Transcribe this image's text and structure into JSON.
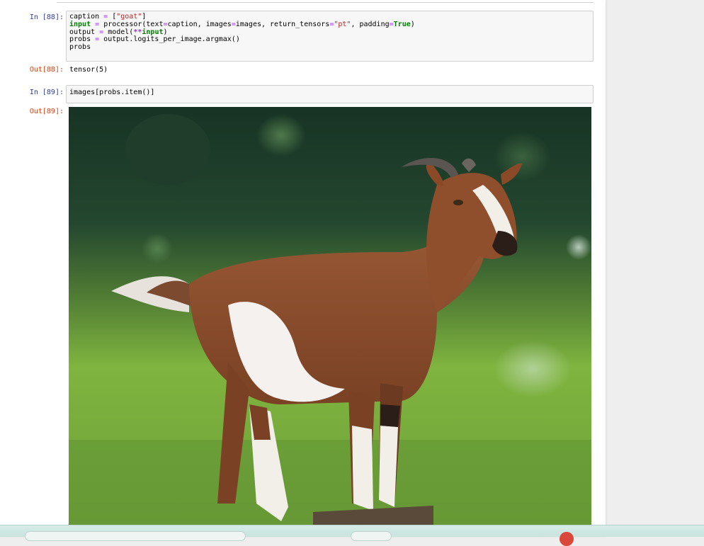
{
  "cells": [
    {
      "in_prompt": "In [88]:",
      "code": {
        "l1": {
          "a": "caption ",
          "b": "=",
          "c": " [",
          "d": "\"goat\"",
          "e": "]"
        },
        "l2": {
          "a": "input",
          "b": " ",
          "c": "=",
          "d": " processor(text",
          "e": "=",
          "f": "caption, images",
          "g": "=",
          "h": "images, return_tensors",
          "i": "=",
          "j": "\"pt\"",
          "k": ", padding",
          "l": "=",
          "m": "True",
          "n": ")"
        },
        "l3": {
          "a": "output ",
          "b": "=",
          "c": " model(",
          "d": "**",
          "e": "input",
          "f": ")"
        },
        "l4": {
          "a": "probs ",
          "b": "=",
          "c": " output.logits_per_image.argmax()"
        },
        "l5": {
          "a": "probs"
        }
      },
      "out_prompt": "Out[88]:",
      "output": "tensor(5)"
    },
    {
      "in_prompt": "In [89]:",
      "code_text": "images[probs.item()]",
      "out_prompt": "Out[89]:",
      "output_image": "goat-photo"
    }
  ],
  "colors": {
    "in_prompt": "#303f9f",
    "out_prompt": "#d84315",
    "keyword": "#008000",
    "string": "#ba2121",
    "operator": "#aa22ff"
  }
}
